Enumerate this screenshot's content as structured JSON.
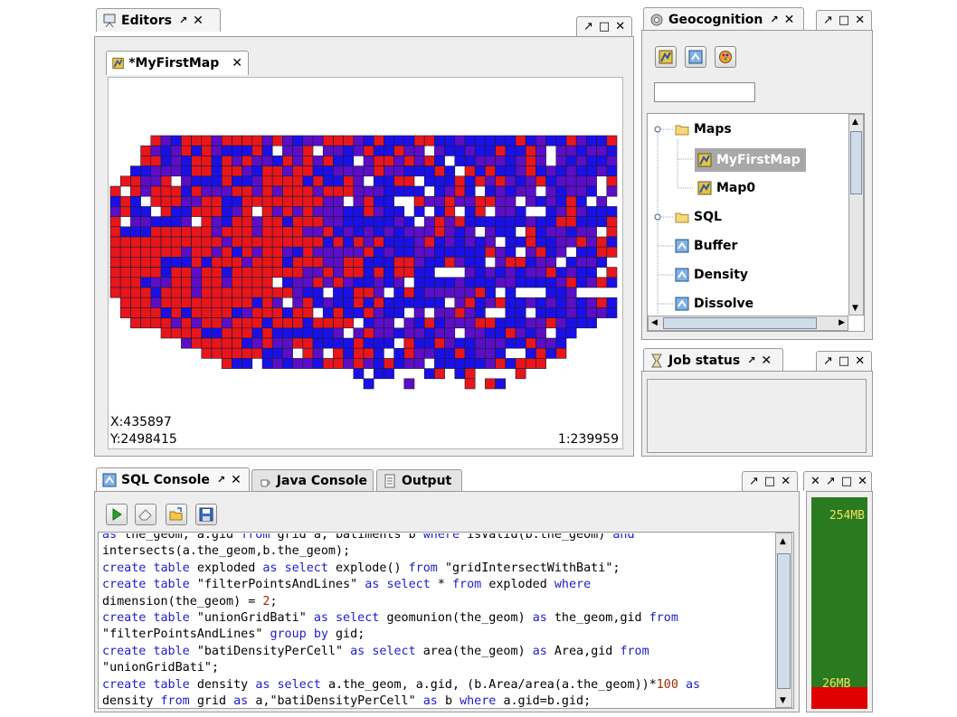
{
  "editors_panel": {
    "tab_label": "Editors",
    "doc_tab_label": "*MyFirstMap",
    "coord_x": "X:435897",
    "coord_y": "Y:2498415",
    "scale": "1:239959"
  },
  "geocognition_panel": {
    "tab_label": "Geocognition",
    "search_value": "",
    "tree": {
      "maps_folder": "Maps",
      "map_item_1": "MyFirstMap",
      "map_item_2": "Map0",
      "sql_folder": "SQL",
      "sql_item_1": "Buffer",
      "sql_item_2": "Density",
      "sql_item_3": "Dissolve"
    }
  },
  "job_status_panel": {
    "tab_label": "Job status"
  },
  "console_panel": {
    "tabs": [
      "SQL Console",
      "Java Console",
      "Output"
    ],
    "code_lines": [
      "as the_geom, a.gid from grid a, batiments b where isValid(b.the_geom) and",
      "intersects(a.the_geom,b.the_geom);",
      "create table exploded as select explode() from \"gridIntersectWithBati\";",
      "create table \"filterPointsAndLines\" as select * from exploded where",
      "dimension(the_geom) = 2;",
      "create table \"unionGridBati\" as select geomunion(the_geom) as the_geom,gid from",
      "\"filterPointsAndLines\" group by gid;",
      "create table \"batiDensityPerCell\" as select area(the_geom) as Area,gid from",
      "\"unionGridBati\";",
      "create table density as select a.the_geom, a.gid, (b.Area/area(a.the_geom))*100 as",
      "density from grid as a,\"batiDensityPerCell\" as b where a.gid=b.gid;"
    ]
  },
  "memory_panel": {
    "max_label": "254MB",
    "used_label": "26MB",
    "used_fraction": 0.102,
    "colors": {
      "free": "#2a7a1f",
      "used": "#e00000"
    }
  },
  "map_colors": {
    "red": "#e8161a",
    "blue": "#1a10e6",
    "purple": "#5b0ec6"
  }
}
